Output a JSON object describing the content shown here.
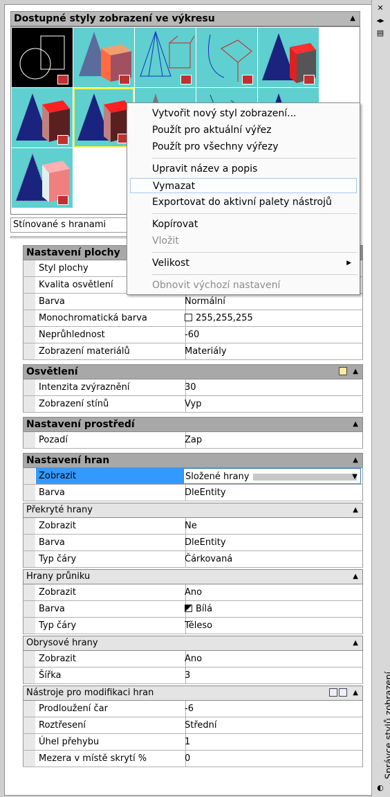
{
  "palette_title": "Správce stylů zobrazení",
  "gallery": {
    "header": "Dostupné styly zobrazení ve výkresu",
    "selected_caption": "Stínované s hranami"
  },
  "context_menu": {
    "items": [
      {
        "label": "Vytvořit nový styl zobrazení...",
        "enabled": true
      },
      {
        "label": "Použít pro aktuální výřez",
        "enabled": true
      },
      {
        "label": "Použít pro všechny výřezy",
        "enabled": true
      },
      {
        "label": "Upravit název a popis",
        "enabled": true
      },
      {
        "label": "Vymazat",
        "enabled": true,
        "hover": true
      },
      {
        "label": "Exportovat do aktivní palety nástrojů",
        "enabled": true
      },
      {
        "label": "Kopírovat",
        "enabled": true
      },
      {
        "label": "Vložit",
        "enabled": false
      },
      {
        "label": "Velikost",
        "enabled": true,
        "submenu": true
      },
      {
        "label": "Obnovit výchozí nastavení",
        "enabled": false
      }
    ]
  },
  "sections": {
    "face": {
      "title": "Nastavení plochy",
      "rows": [
        {
          "label": "Styl plochy",
          "value": ""
        },
        {
          "label": "Kvalita osvětlení",
          "value": ""
        },
        {
          "label": "Barva",
          "value": "Normální"
        },
        {
          "label": "Monochromatická barva",
          "value": "255,255,255"
        },
        {
          "label": "Neprůhlednost",
          "value": "-60"
        },
        {
          "label": "Zobrazení materiálů",
          "value": "Materiály"
        }
      ]
    },
    "lighting": {
      "title": "Osvětlení",
      "rows": [
        {
          "label": "Intenzita zvýraznění",
          "value": "30"
        },
        {
          "label": "Zobrazení stínů",
          "value": "Vyp"
        }
      ]
    },
    "environment": {
      "title": "Nastavení prostředí",
      "rows": [
        {
          "label": "Pozadí",
          "value": "Zap"
        }
      ]
    },
    "edges": {
      "title": "Nastavení hran",
      "rows": [
        {
          "label": "Zobrazit",
          "value": "Složené hrany"
        },
        {
          "label": "Barva",
          "value": "DleEntity"
        }
      ]
    },
    "occluded": {
      "title": "Překryté hrany",
      "rows": [
        {
          "label": "Zobrazit",
          "value": "Ne"
        },
        {
          "label": "Barva",
          "value": "DleEntity"
        },
        {
          "label": "Typ čáry",
          "value": "Čárkovaná"
        }
      ]
    },
    "intersection": {
      "title": "Hrany průniku",
      "rows": [
        {
          "label": "Zobrazit",
          "value": "Ano"
        },
        {
          "label": "Barva",
          "value": "Bílá"
        },
        {
          "label": "Typ čáry",
          "value": "Těleso"
        }
      ]
    },
    "silhouette": {
      "title": "Obrysové hrany",
      "rows": [
        {
          "label": "Zobrazit",
          "value": "Ano"
        },
        {
          "label": "Šířka",
          "value": "3"
        }
      ]
    },
    "modifiers": {
      "title": "Nástroje pro modifikaci hran",
      "rows": [
        {
          "label": "Prodloužení čar",
          "value": "-6"
        },
        {
          "label": "Roztřesení",
          "value": "Střední"
        },
        {
          "label": "Úhel přehybu",
          "value": "1"
        },
        {
          "label": "Mezera v místě skrytí %",
          "value": "0"
        }
      ]
    }
  },
  "colors": {
    "thumb_bg": "#5fcfcf",
    "selection_blue": "#3399ff",
    "selected_thumb_border": "#f0f04a"
  }
}
